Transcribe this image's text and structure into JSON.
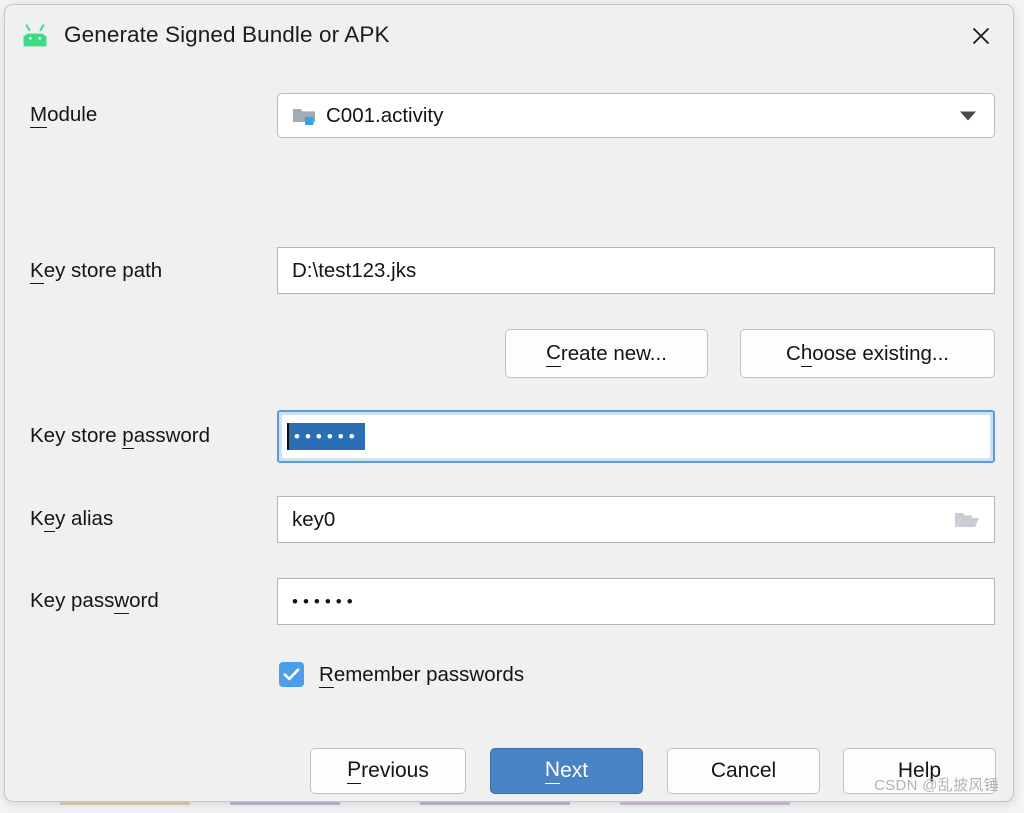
{
  "dialog": {
    "title": "Generate Signed Bundle or APK",
    "app_icon": "android-robot-icon",
    "close_icon": "close-icon",
    "accent_color": "#4a83c4",
    "checkbox_color": "#4a9eea",
    "selection_color": "#2a6fb5",
    "android_green": "#3ddc84"
  },
  "fields": {
    "module": {
      "label_prefix": "",
      "label_accesskey": "M",
      "label_suffix": "odule",
      "value": "C001.activity",
      "icon": "module-folder-icon",
      "dropdown_icon": "chevron-down-icon"
    },
    "keystore_path": {
      "label_accesskey": "K",
      "label_suffix": "ey store path",
      "value": "D:\\test123.jks"
    },
    "keystore_password": {
      "label_prefix": "Key store ",
      "label_accesskey": "p",
      "label_suffix": "assword",
      "value": "••••••",
      "masked_length": 6,
      "selected": true,
      "focused": true
    },
    "key_alias": {
      "label_prefix": "K",
      "label_accesskey": "e",
      "label_suffix": "y alias",
      "value": "key0",
      "browse_icon": "folder-open-icon"
    },
    "key_password": {
      "label_prefix": "Key pass",
      "label_accesskey": "w",
      "label_suffix": "ord",
      "value": "••••••",
      "masked_length": 6
    }
  },
  "keystore_buttons": {
    "create_new": {
      "prefix": "",
      "accesskey": "C",
      "suffix": "reate new..."
    },
    "choose_existing": {
      "prefix": "C",
      "accesskey": "h",
      "suffix": "oose existing..."
    }
  },
  "remember": {
    "checked": true,
    "prefix": "",
    "accesskey": "R",
    "suffix": "emember passwords",
    "check_icon": "checkmark-icon"
  },
  "actions": {
    "previous": {
      "prefix": "",
      "accesskey": "P",
      "suffix": "revious"
    },
    "next": {
      "prefix": "",
      "accesskey": "N",
      "suffix": "ext"
    },
    "cancel": {
      "prefix": "Cancel",
      "accesskey": "",
      "suffix": ""
    },
    "help": {
      "prefix": "Help",
      "accesskey": "",
      "suffix": ""
    }
  },
  "watermark": "CSDN @乱披风锤"
}
